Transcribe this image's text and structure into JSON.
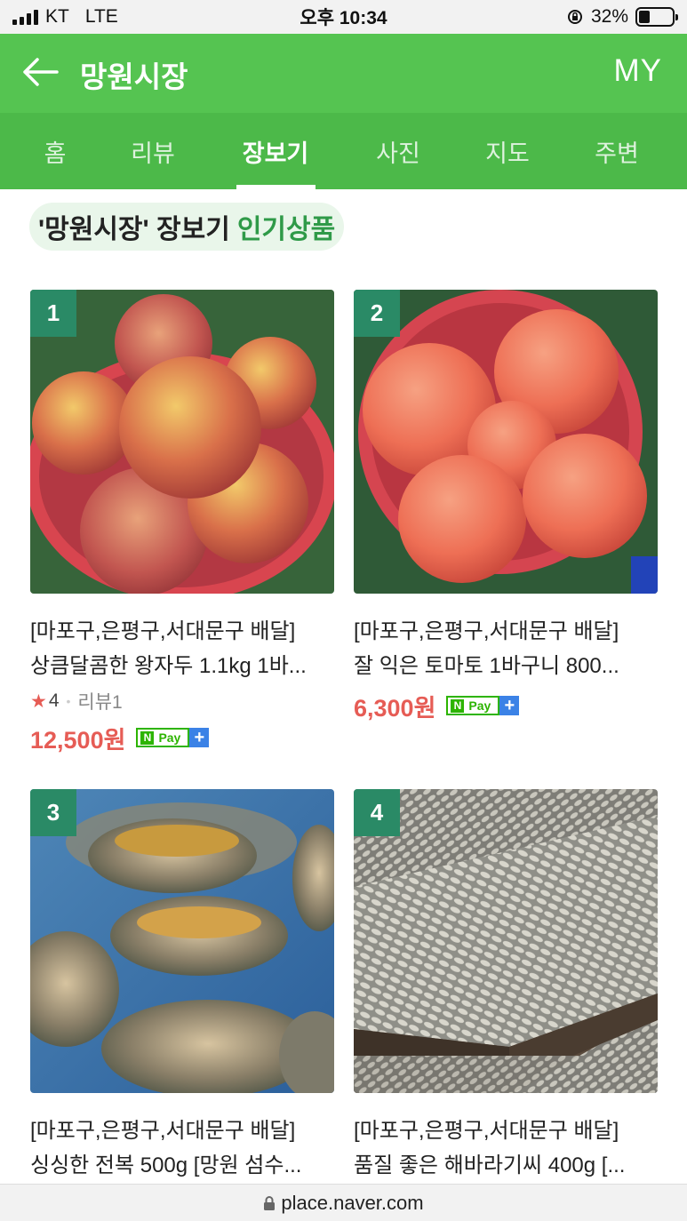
{
  "status_bar": {
    "carrier": "KT",
    "network": "LTE",
    "time": "오후 10:34",
    "battery_percent": "32%",
    "battery_level": 0.32
  },
  "header": {
    "title": "망원시장",
    "my_label": "MY"
  },
  "tabs": [
    {
      "label": "홈"
    },
    {
      "label": "리뷰"
    },
    {
      "label": "장보기",
      "active": true
    },
    {
      "label": "사진"
    },
    {
      "label": "지도"
    },
    {
      "label": "주변"
    }
  ],
  "section": {
    "title_main": "'망원시장' 장보기",
    "title_highlight": "인기상품"
  },
  "products": [
    {
      "rank": "1",
      "image": "plums-in-basket",
      "category": "[마포구,은평구,서대문구 배달]",
      "name": "상큼달콤한 왕자두 1.1kg 1바...",
      "rating": "4",
      "review": "리뷰1",
      "price": "12,500원",
      "npay": "Pay"
    },
    {
      "rank": "2",
      "image": "tomatoes-in-basket",
      "category": "[마포구,은평구,서대문구 배달]",
      "name": "잘 익은 토마토 1바구니 800...",
      "price": "6,300원",
      "npay": "Pay"
    },
    {
      "rank": "3",
      "image": "abalone",
      "category": "[마포구,은평구,서대문구 배달]",
      "name": "싱싱한 전복 500g [망원 섬수..."
    },
    {
      "rank": "4",
      "image": "sunflower-seeds",
      "category": "[마포구,은평구,서대문구 배달]",
      "name": "품질 좋은 해바라기씨 400g [..."
    }
  ],
  "url_bar": {
    "url": "place.naver.com"
  },
  "colors": {
    "header_green": "#55c451",
    "tab_green": "#4cb949",
    "rank_badge": "#2a8a66",
    "price_red": "#e65c55",
    "highlight_green": "#2f9a48"
  }
}
